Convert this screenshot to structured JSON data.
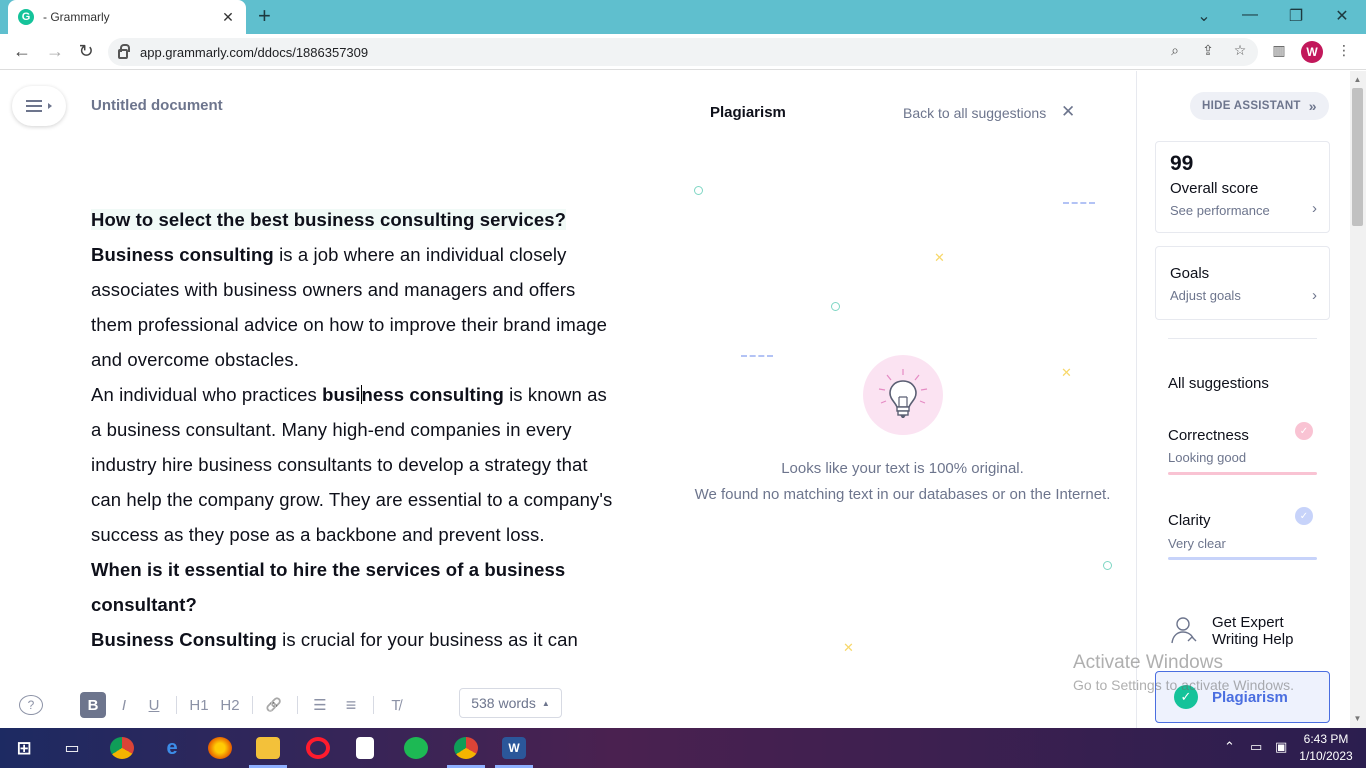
{
  "browser": {
    "tab_title": "- Grammarly",
    "tab_favicon": "G",
    "url": "app.grammarly.com/ddocs/1886357309",
    "profile_initial": "W"
  },
  "document": {
    "title": "Untitled document",
    "heading1": "How to select the best business consulting services?",
    "p1_bold": "Business consulting",
    "p1_rest": " is a job where an individual closely associates with business owners and managers and offers them professional advice on how to improve their brand image and overcome obstacles.",
    "p2_start": "An individual who practices ",
    "p2_bold_a": "busi",
    "p2_bold_b": "ness consulting",
    "p2_rest": " is known as a business consultant. Many high-end companies in every industry hire business consultants to develop a strategy that can help the company grow. They are essential to a company's success as they pose as a backbone and prevent loss.",
    "heading2": "When is it essential to hire the services of a business consultant?",
    "p3_bold": "Business Consulting",
    "p3_rest": " is crucial for your business as it can"
  },
  "format_bar": {
    "help": "?",
    "bold": "B",
    "italic": "I",
    "underline": "U",
    "h1": "H1",
    "h2": "H2",
    "link": "🔗",
    "ordered": "☰",
    "unordered": "≡",
    "clear": "T̸",
    "word_count": "538 words",
    "word_caret": "▲"
  },
  "plagiarism": {
    "title": "Plagiarism",
    "back": "Back to all suggestions",
    "close": "✕",
    "message1": "Looks like your text is 100% original.",
    "message2": "We found no matching text in our databases or on the Internet."
  },
  "assistant": {
    "hide_label": "HIDE ASSISTANT",
    "hide_chevron": "»",
    "score": "99",
    "score_label": "Overall score",
    "score_link": "See performance",
    "goals_label": "Goals",
    "goals_link": "Adjust goals",
    "chevron": "›",
    "all_suggestions": "All suggestions",
    "correctness": {
      "name": "Correctness",
      "status": "Looking good",
      "color": "#f28ba8"
    },
    "clarity": {
      "name": "Clarity",
      "status": "Very clear",
      "color": "#4a6ee0"
    },
    "expert": "Get Expert Writing Help",
    "plagiarism_btn": "Plagiarism",
    "check": "✓"
  },
  "watermark": {
    "line1": "Activate Windows",
    "line2": "Go to Settings to activate Windows."
  },
  "taskbar": {
    "time": "6:43 PM",
    "date": "1/10/2023"
  },
  "colors": {
    "accent": "#15c39a",
    "tabbar": "#5fbfce",
    "plag_blue": "#4a6ee0"
  }
}
